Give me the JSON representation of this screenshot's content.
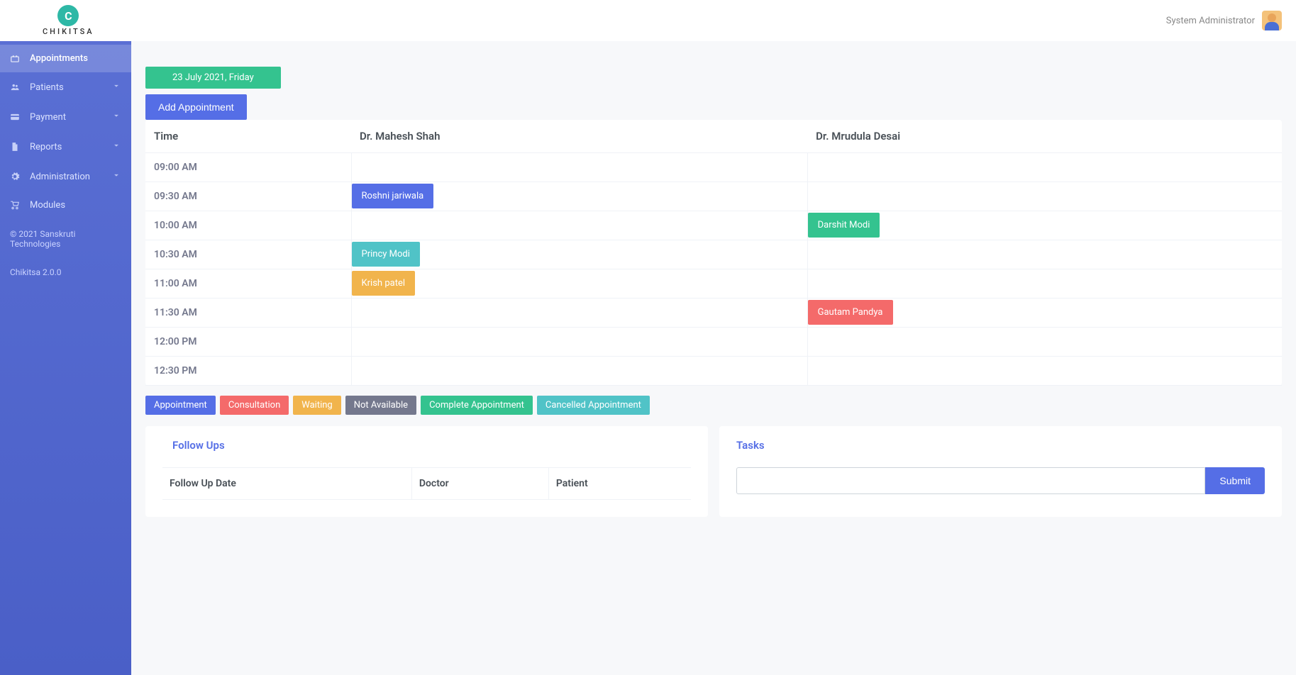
{
  "brand": {
    "logo_letter": "C",
    "name": "CHIKITSA"
  },
  "header": {
    "user_label": "System Administrator"
  },
  "sidebar": {
    "items": [
      {
        "label": "Appointments",
        "icon": "briefcase",
        "active": true,
        "expandable": false
      },
      {
        "label": "Patients",
        "icon": "users",
        "active": false,
        "expandable": true
      },
      {
        "label": "Payment",
        "icon": "card",
        "active": false,
        "expandable": true
      },
      {
        "label": "Reports",
        "icon": "file",
        "active": false,
        "expandable": true
      },
      {
        "label": "Administration",
        "icon": "gear",
        "active": false,
        "expandable": true
      },
      {
        "label": "Modules",
        "icon": "cart",
        "active": false,
        "expandable": false
      }
    ],
    "copyright": "© 2021 Sanskruti Technologies",
    "version": "Chikitsa 2.0.0"
  },
  "schedule": {
    "date_label": "23 July 2021, Friday",
    "add_button": "Add Appointment",
    "columns": [
      {
        "key": "time",
        "label": "Time"
      },
      {
        "key": "doc1",
        "label": "Dr. Mahesh Shah"
      },
      {
        "key": "doc2",
        "label": "Dr. Mrudula Desai"
      }
    ],
    "rows": [
      {
        "time": "09:00 AM",
        "doc1": null,
        "doc2": null
      },
      {
        "time": "09:30 AM",
        "doc1": {
          "name": "Roshni jariwala",
          "color": "c-blue"
        },
        "doc2": null
      },
      {
        "time": "10:00 AM",
        "doc1": null,
        "doc2": {
          "name": "Darshit Modi",
          "color": "c-green"
        }
      },
      {
        "time": "10:30 AM",
        "doc1": {
          "name": "Princy Modi",
          "color": "c-teal"
        },
        "doc2": null
      },
      {
        "time": "11:00 AM",
        "doc1": {
          "name": "Krish patel",
          "color": "c-yellow"
        },
        "doc2": null
      },
      {
        "time": "11:30 AM",
        "doc1": null,
        "doc2": {
          "name": "Gautam Pandya",
          "color": "c-red"
        }
      },
      {
        "time": "12:00 PM",
        "doc1": null,
        "doc2": null
      },
      {
        "time": "12:30 PM",
        "doc1": null,
        "doc2": null
      }
    ]
  },
  "legend": [
    {
      "label": "Appointment",
      "color": "c-blue"
    },
    {
      "label": "Consultation",
      "color": "c-red"
    },
    {
      "label": "Waiting",
      "color": "c-yellow"
    },
    {
      "label": "Not Available",
      "color": "c-gray"
    },
    {
      "label": "Complete Appointment",
      "color": "c-green"
    },
    {
      "label": "Cancelled Appointment",
      "color": "c-teal"
    }
  ],
  "followups": {
    "title": "Follow Ups",
    "columns": [
      "Follow Up Date",
      "Doctor",
      "Patient"
    ]
  },
  "tasks": {
    "title": "Tasks",
    "input_placeholder": "",
    "submit_label": "Submit"
  }
}
